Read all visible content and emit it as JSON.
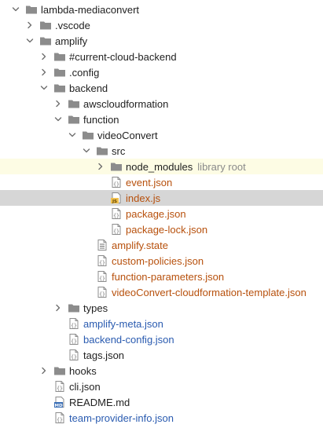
{
  "colors": {
    "text": "#1f1f1f",
    "modified": "#b7500c",
    "added": "#2a5bb0",
    "hint": "#8a8a8a",
    "folder": "#8c8c8c",
    "highlight_library": "#fdfce4",
    "selected_row": "#d6d6d6"
  },
  "tree": {
    "items": [
      {
        "label": "lambda-mediaconvert",
        "depth": 0,
        "expandable": true,
        "expanded": true,
        "icon": "folder-icon",
        "status": "normal"
      },
      {
        "label": ".vscode",
        "depth": 1,
        "expandable": true,
        "expanded": false,
        "icon": "folder-icon",
        "status": "normal"
      },
      {
        "label": "amplify",
        "depth": 1,
        "expandable": true,
        "expanded": true,
        "icon": "folder-icon",
        "status": "normal"
      },
      {
        "label": "#current-cloud-backend",
        "depth": 2,
        "expandable": true,
        "expanded": false,
        "icon": "folder-icon",
        "status": "normal"
      },
      {
        "label": ".config",
        "depth": 2,
        "expandable": true,
        "expanded": false,
        "icon": "folder-icon",
        "status": "normal"
      },
      {
        "label": "backend",
        "depth": 2,
        "expandable": true,
        "expanded": true,
        "icon": "folder-icon",
        "status": "normal"
      },
      {
        "label": "awscloudformation",
        "depth": 3,
        "expandable": true,
        "expanded": false,
        "icon": "folder-icon",
        "status": "normal"
      },
      {
        "label": "function",
        "depth": 3,
        "expandable": true,
        "expanded": true,
        "icon": "folder-icon",
        "status": "normal"
      },
      {
        "label": "videoConvert",
        "depth": 4,
        "expandable": true,
        "expanded": true,
        "icon": "folder-icon",
        "status": "normal"
      },
      {
        "label": "src",
        "depth": 5,
        "expandable": true,
        "expanded": true,
        "icon": "folder-icon",
        "status": "normal"
      },
      {
        "label": "node_modules",
        "hint": "library root",
        "depth": 6,
        "expandable": true,
        "expanded": false,
        "icon": "folder-icon",
        "status": "normal",
        "highlight": "library"
      },
      {
        "label": "event.json",
        "depth": 6,
        "expandable": false,
        "icon": "json-file-icon",
        "status": "modified"
      },
      {
        "label": "index.js",
        "depth": 6,
        "expandable": false,
        "icon": "js-file-icon",
        "status": "modified",
        "highlight": "selected"
      },
      {
        "label": "package.json",
        "depth": 6,
        "expandable": false,
        "icon": "json-file-icon",
        "status": "modified"
      },
      {
        "label": "package-lock.json",
        "depth": 6,
        "expandable": false,
        "icon": "json-file-icon",
        "status": "modified"
      },
      {
        "label": "amplify.state",
        "depth": 5,
        "expandable": false,
        "icon": "text-file-icon",
        "status": "modified"
      },
      {
        "label": "custom-policies.json",
        "depth": 5,
        "expandable": false,
        "icon": "json-file-icon",
        "status": "modified"
      },
      {
        "label": "function-parameters.json",
        "depth": 5,
        "expandable": false,
        "icon": "json-file-icon",
        "status": "modified"
      },
      {
        "label": "videoConvert-cloudformation-template.json",
        "depth": 5,
        "expandable": false,
        "icon": "json-file-icon",
        "status": "modified"
      },
      {
        "label": "types",
        "depth": 3,
        "expandable": true,
        "expanded": false,
        "icon": "folder-icon",
        "status": "normal"
      },
      {
        "label": "amplify-meta.json",
        "depth": 3,
        "expandable": false,
        "icon": "json-file-icon",
        "status": "added"
      },
      {
        "label": "backend-config.json",
        "depth": 3,
        "expandable": false,
        "icon": "json-file-icon",
        "status": "added"
      },
      {
        "label": "tags.json",
        "depth": 3,
        "expandable": false,
        "icon": "json-file-icon",
        "status": "normal"
      },
      {
        "label": "hooks",
        "depth": 2,
        "expandable": true,
        "expanded": false,
        "icon": "folder-icon",
        "status": "normal"
      },
      {
        "label": "cli.json",
        "depth": 2,
        "expandable": false,
        "icon": "json-file-icon",
        "status": "normal"
      },
      {
        "label": "README.md",
        "depth": 2,
        "expandable": false,
        "icon": "markdown-file-icon",
        "status": "normal"
      },
      {
        "label": "team-provider-info.json",
        "depth": 2,
        "expandable": false,
        "icon": "json-file-icon",
        "status": "added"
      }
    ]
  }
}
